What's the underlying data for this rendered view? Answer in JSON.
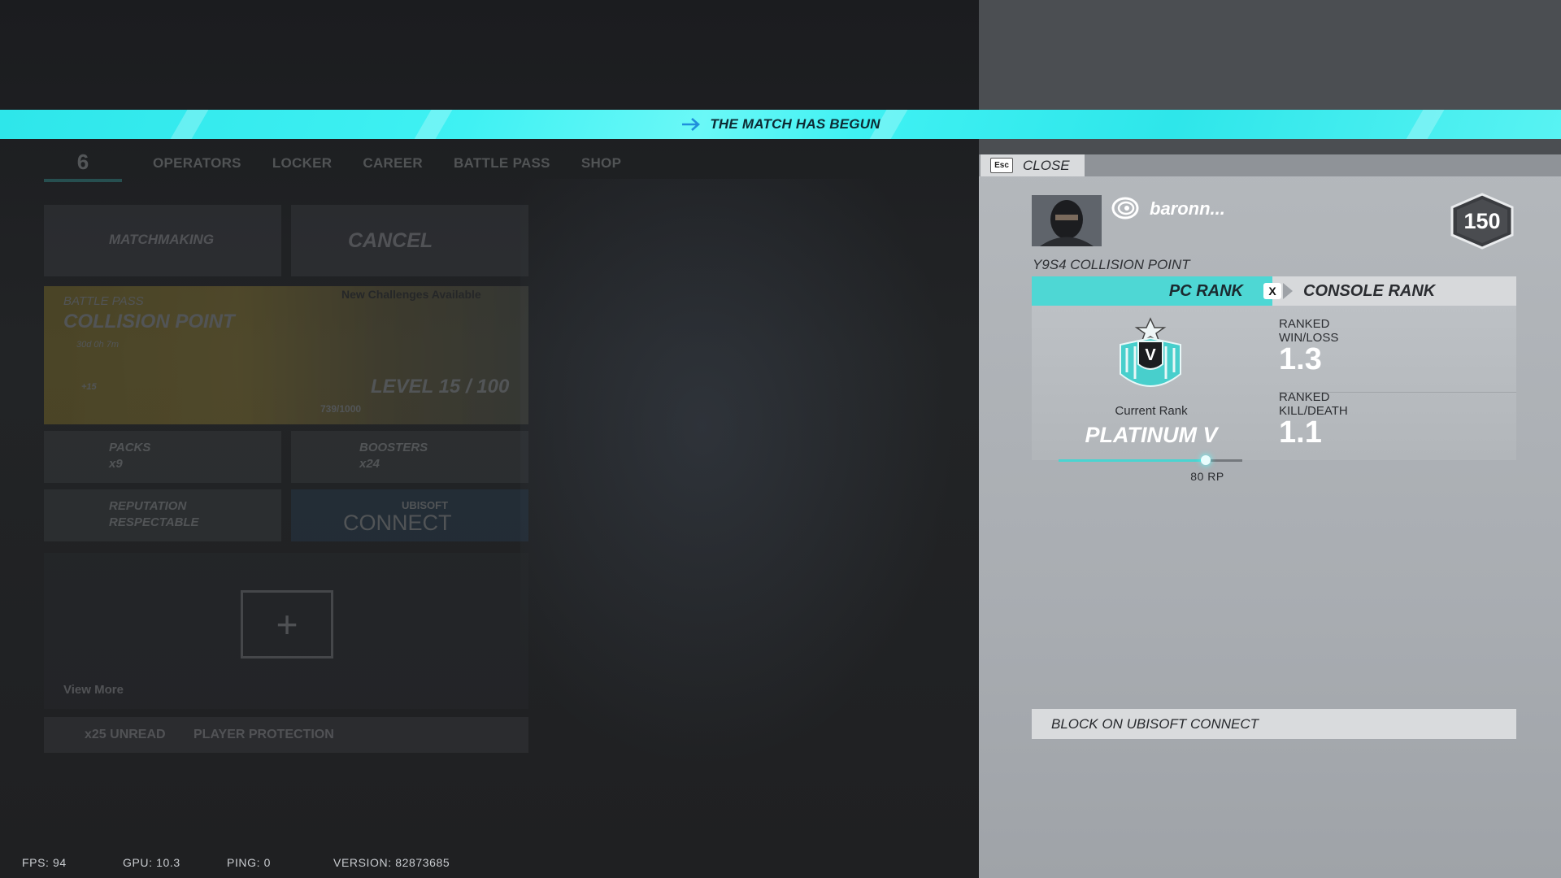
{
  "banner": {
    "text": "THE MATCH HAS BEGUN"
  },
  "nav": {
    "items": [
      "OPERATORS",
      "LOCKER",
      "CAREER",
      "BATTLE PASS",
      "SHOP"
    ]
  },
  "menu": {
    "matchmaking": "MATCHMAKING",
    "cancel": "CANCEL",
    "battle_pass_label": "BATTLE PASS",
    "battle_pass_title": "COLLISION POINT",
    "battle_pass_timer": "30d 0h 7m",
    "battle_pass_bonus": "+15",
    "battle_pass_challenges": "New Challenges Available",
    "battle_pass_level": "LEVEL 15 / 100",
    "battle_pass_xp": "739/1000",
    "packs_label": "PACKS",
    "packs_count": "x9",
    "boosters_label": "BOOSTERS",
    "boosters_count": "x24",
    "reputation_label": "REPUTATION",
    "reputation_value": "RESPECTABLE",
    "ubisoft_connect_top": "UBISOFT",
    "ubisoft_connect_bottom": "CONNECT",
    "view_more": "View More",
    "unread": "x25 UNREAD",
    "player_protection": "PLAYER PROTECTION"
  },
  "stats": {
    "fps": "FPS: 94",
    "gpu": "GPU: 10.3",
    "ping": "PING: 0",
    "version": "VERSION: 82873685"
  },
  "profile_panel": {
    "close_key": "Esc",
    "close_label": "CLOSE",
    "username": "baronn...",
    "level": "150",
    "season": "Y9S4 COLLISION POINT",
    "tab_pc": "PC RANK",
    "tab_console": "CONSOLE RANK",
    "tab_switch_key": "X",
    "rank_emblem_letter": "V",
    "current_rank_label": "Current Rank",
    "rank_name": "PLATINUM V",
    "rp_label": "80 RP",
    "rp_progress": 0.8,
    "win_loss_label_1": "RANKED",
    "win_loss_label_2": "WIN/LOSS",
    "win_loss_value": "1.3",
    "kill_death_label_1": "RANKED",
    "kill_death_label_2": "KILL/DEATH",
    "kill_death_value": "1.1",
    "block_label": "BLOCK ON UBISOFT CONNECT"
  },
  "colors": {
    "accent": "#4ed7d4",
    "banner": "#3ff1f3"
  }
}
